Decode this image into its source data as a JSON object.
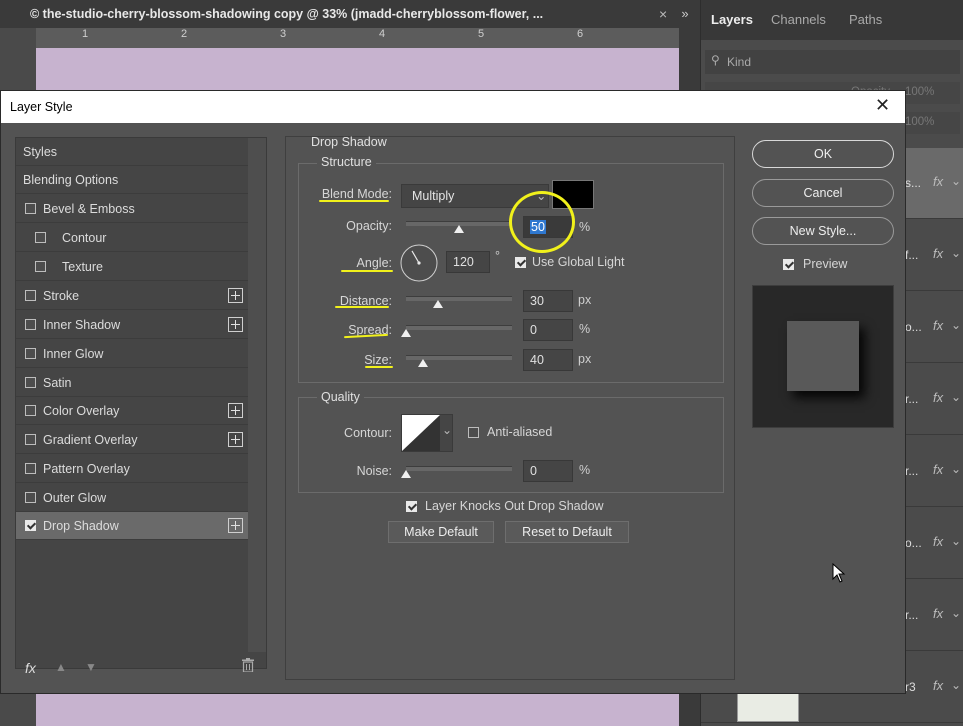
{
  "document": {
    "tab_title": "© the-studio-cherry-blossom-shadowing copy @ 33% (jmadd-cherryblossom-flower, ...",
    "close": "×",
    "collapse": "»",
    "ruler_ticks": [
      "1",
      "2",
      "3",
      "4",
      "5",
      "6"
    ]
  },
  "layers_panel": {
    "tabs": [
      "Layers",
      "Channels",
      "Paths"
    ],
    "kind_label": "Kind",
    "opacity_label": "Opacity",
    "opacity_value": "100%",
    "fill_value": "100%",
    "rows": [
      {
        "name_tail": "s...",
        "fx": "fx"
      },
      {
        "name_tail": "f...",
        "fx": "fx"
      },
      {
        "name_tail": "o...",
        "fx": "fx"
      },
      {
        "name_tail": "r...",
        "fx": "fx"
      },
      {
        "name_tail": "r...",
        "fx": "fx"
      },
      {
        "name_tail": "o...",
        "fx": "fx"
      },
      {
        "name_tail": "r...",
        "fx": "fx"
      },
      {
        "name_tail": "r3",
        "fx": "fx"
      }
    ]
  },
  "dialog": {
    "title": "Layer Style",
    "close": "✕",
    "styles_list": {
      "items": [
        {
          "label": "Styles",
          "checkbox": false,
          "checked": false,
          "plus": false,
          "indent": 0
        },
        {
          "label": "Blending Options",
          "checkbox": false,
          "checked": false,
          "plus": false,
          "indent": 0
        },
        {
          "label": "Bevel & Emboss",
          "checkbox": true,
          "checked": false,
          "plus": false,
          "indent": 0
        },
        {
          "label": "Contour",
          "checkbox": true,
          "checked": false,
          "plus": false,
          "indent": 1
        },
        {
          "label": "Texture",
          "checkbox": true,
          "checked": false,
          "plus": false,
          "indent": 1
        },
        {
          "label": "Stroke",
          "checkbox": true,
          "checked": false,
          "plus": true,
          "indent": 0
        },
        {
          "label": "Inner Shadow",
          "checkbox": true,
          "checked": false,
          "plus": true,
          "indent": 0
        },
        {
          "label": "Inner Glow",
          "checkbox": true,
          "checked": false,
          "plus": false,
          "indent": 0
        },
        {
          "label": "Satin",
          "checkbox": true,
          "checked": false,
          "plus": false,
          "indent": 0
        },
        {
          "label": "Color Overlay",
          "checkbox": true,
          "checked": false,
          "plus": true,
          "indent": 0
        },
        {
          "label": "Gradient Overlay",
          "checkbox": true,
          "checked": false,
          "plus": true,
          "indent": 0
        },
        {
          "label": "Pattern Overlay",
          "checkbox": true,
          "checked": false,
          "plus": false,
          "indent": 0
        },
        {
          "label": "Outer Glow",
          "checkbox": true,
          "checked": false,
          "plus": false,
          "indent": 0
        },
        {
          "label": "Drop Shadow",
          "checkbox": true,
          "checked": true,
          "plus": true,
          "indent": 0,
          "selected": true
        }
      ],
      "footer_fx": "fx"
    },
    "drop_shadow": {
      "section_title": "Drop Shadow",
      "structure_title": "Structure",
      "blend_mode_label": "Blend Mode:",
      "blend_mode_value": "Multiply",
      "shadow_color": "#000000",
      "opacity_label": "Opacity:",
      "opacity_value": "50",
      "opacity_fraction": 0.5,
      "pct": "%",
      "angle_label": "Angle:",
      "angle_value": "120",
      "degree_symbol": "°",
      "use_global_light_label": "Use Global Light",
      "use_global_light_checked": true,
      "distance_label": "Distance:",
      "distance_value": "30",
      "distance_fraction": 0.3,
      "px": "px",
      "spread_label": "Spread:",
      "spread_value": "0",
      "spread_fraction": 0.0,
      "size_label": "Size:",
      "size_value": "40",
      "size_fraction": 0.16,
      "quality_title": "Quality",
      "contour_label": "Contour:",
      "anti_aliased_label": "Anti-aliased",
      "anti_aliased_checked": false,
      "noise_label": "Noise:",
      "noise_value": "0",
      "noise_fraction": 0.0,
      "knocks_out_label": "Layer Knocks Out Drop Shadow",
      "knocks_out_checked": true,
      "make_default_label": "Make Default",
      "reset_default_label": "Reset to Default"
    },
    "actions": {
      "ok_label": "OK",
      "cancel_label": "Cancel",
      "new_style_label": "New Style...",
      "preview_label": "Preview",
      "preview_checked": true
    },
    "colors": {
      "highlight_yellow": "#f1f11b",
      "dialog_bg": "#535353",
      "canvas_lilac": "#c7b3cf"
    }
  }
}
